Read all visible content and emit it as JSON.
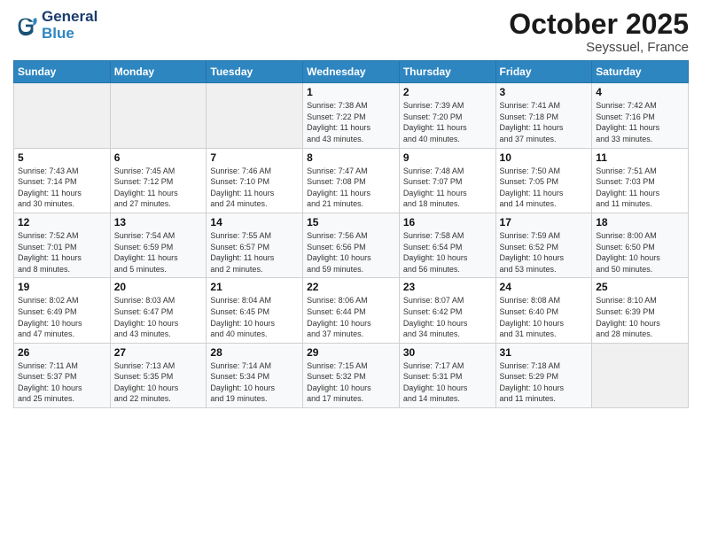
{
  "header": {
    "logo_line1": "General",
    "logo_line2": "Blue",
    "month": "October 2025",
    "location": "Seyssuel, France"
  },
  "days_of_week": [
    "Sunday",
    "Monday",
    "Tuesday",
    "Wednesday",
    "Thursday",
    "Friday",
    "Saturday"
  ],
  "weeks": [
    [
      {
        "num": "",
        "info": ""
      },
      {
        "num": "",
        "info": ""
      },
      {
        "num": "",
        "info": ""
      },
      {
        "num": "1",
        "info": "Sunrise: 7:38 AM\nSunset: 7:22 PM\nDaylight: 11 hours\nand 43 minutes."
      },
      {
        "num": "2",
        "info": "Sunrise: 7:39 AM\nSunset: 7:20 PM\nDaylight: 11 hours\nand 40 minutes."
      },
      {
        "num": "3",
        "info": "Sunrise: 7:41 AM\nSunset: 7:18 PM\nDaylight: 11 hours\nand 37 minutes."
      },
      {
        "num": "4",
        "info": "Sunrise: 7:42 AM\nSunset: 7:16 PM\nDaylight: 11 hours\nand 33 minutes."
      }
    ],
    [
      {
        "num": "5",
        "info": "Sunrise: 7:43 AM\nSunset: 7:14 PM\nDaylight: 11 hours\nand 30 minutes."
      },
      {
        "num": "6",
        "info": "Sunrise: 7:45 AM\nSunset: 7:12 PM\nDaylight: 11 hours\nand 27 minutes."
      },
      {
        "num": "7",
        "info": "Sunrise: 7:46 AM\nSunset: 7:10 PM\nDaylight: 11 hours\nand 24 minutes."
      },
      {
        "num": "8",
        "info": "Sunrise: 7:47 AM\nSunset: 7:08 PM\nDaylight: 11 hours\nand 21 minutes."
      },
      {
        "num": "9",
        "info": "Sunrise: 7:48 AM\nSunset: 7:07 PM\nDaylight: 11 hours\nand 18 minutes."
      },
      {
        "num": "10",
        "info": "Sunrise: 7:50 AM\nSunset: 7:05 PM\nDaylight: 11 hours\nand 14 minutes."
      },
      {
        "num": "11",
        "info": "Sunrise: 7:51 AM\nSunset: 7:03 PM\nDaylight: 11 hours\nand 11 minutes."
      }
    ],
    [
      {
        "num": "12",
        "info": "Sunrise: 7:52 AM\nSunset: 7:01 PM\nDaylight: 11 hours\nand 8 minutes."
      },
      {
        "num": "13",
        "info": "Sunrise: 7:54 AM\nSunset: 6:59 PM\nDaylight: 11 hours\nand 5 minutes."
      },
      {
        "num": "14",
        "info": "Sunrise: 7:55 AM\nSunset: 6:57 PM\nDaylight: 11 hours\nand 2 minutes."
      },
      {
        "num": "15",
        "info": "Sunrise: 7:56 AM\nSunset: 6:56 PM\nDaylight: 10 hours\nand 59 minutes."
      },
      {
        "num": "16",
        "info": "Sunrise: 7:58 AM\nSunset: 6:54 PM\nDaylight: 10 hours\nand 56 minutes."
      },
      {
        "num": "17",
        "info": "Sunrise: 7:59 AM\nSunset: 6:52 PM\nDaylight: 10 hours\nand 53 minutes."
      },
      {
        "num": "18",
        "info": "Sunrise: 8:00 AM\nSunset: 6:50 PM\nDaylight: 10 hours\nand 50 minutes."
      }
    ],
    [
      {
        "num": "19",
        "info": "Sunrise: 8:02 AM\nSunset: 6:49 PM\nDaylight: 10 hours\nand 47 minutes."
      },
      {
        "num": "20",
        "info": "Sunrise: 8:03 AM\nSunset: 6:47 PM\nDaylight: 10 hours\nand 43 minutes."
      },
      {
        "num": "21",
        "info": "Sunrise: 8:04 AM\nSunset: 6:45 PM\nDaylight: 10 hours\nand 40 minutes."
      },
      {
        "num": "22",
        "info": "Sunrise: 8:06 AM\nSunset: 6:44 PM\nDaylight: 10 hours\nand 37 minutes."
      },
      {
        "num": "23",
        "info": "Sunrise: 8:07 AM\nSunset: 6:42 PM\nDaylight: 10 hours\nand 34 minutes."
      },
      {
        "num": "24",
        "info": "Sunrise: 8:08 AM\nSunset: 6:40 PM\nDaylight: 10 hours\nand 31 minutes."
      },
      {
        "num": "25",
        "info": "Sunrise: 8:10 AM\nSunset: 6:39 PM\nDaylight: 10 hours\nand 28 minutes."
      }
    ],
    [
      {
        "num": "26",
        "info": "Sunrise: 7:11 AM\nSunset: 5:37 PM\nDaylight: 10 hours\nand 25 minutes."
      },
      {
        "num": "27",
        "info": "Sunrise: 7:13 AM\nSunset: 5:35 PM\nDaylight: 10 hours\nand 22 minutes."
      },
      {
        "num": "28",
        "info": "Sunrise: 7:14 AM\nSunset: 5:34 PM\nDaylight: 10 hours\nand 19 minutes."
      },
      {
        "num": "29",
        "info": "Sunrise: 7:15 AM\nSunset: 5:32 PM\nDaylight: 10 hours\nand 17 minutes."
      },
      {
        "num": "30",
        "info": "Sunrise: 7:17 AM\nSunset: 5:31 PM\nDaylight: 10 hours\nand 14 minutes."
      },
      {
        "num": "31",
        "info": "Sunrise: 7:18 AM\nSunset: 5:29 PM\nDaylight: 10 hours\nand 11 minutes."
      },
      {
        "num": "",
        "info": ""
      }
    ]
  ]
}
